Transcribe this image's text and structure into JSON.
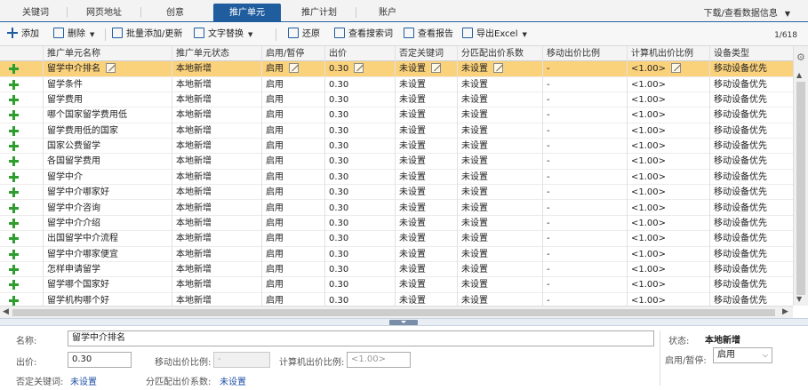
{
  "tabs": [
    {
      "label": "关键词",
      "active": false
    },
    {
      "label": "网页地址",
      "active": false
    },
    {
      "label": "创意",
      "active": false
    },
    {
      "label": "推广单元",
      "active": true
    },
    {
      "label": "推广计划",
      "active": false
    },
    {
      "label": "账户",
      "active": false
    }
  ],
  "download_label": "下载/查看数据信息",
  "toolbar": {
    "add": "添加",
    "delete": "删除",
    "batch": "批量添加/更新",
    "replace": "文字替换",
    "restore": "还原",
    "search_terms": "查看搜索词",
    "report": "查看报告",
    "export": "导出Excel",
    "page_count": "1/618"
  },
  "columns": [
    "推广单元名称",
    "推广单元状态",
    "启用/暂停",
    "出价",
    "否定关键词",
    "分匹配出价系数",
    "移动出价比例",
    "计算机出价比例",
    "设备类型"
  ],
  "rows": [
    [
      "留学中介排名",
      "本地新增",
      "启用",
      "0.30",
      "未设置",
      "未设置",
      "-",
      "<1.00>",
      "移动设备优先"
    ],
    [
      "留学条件",
      "本地新增",
      "启用",
      "0.30",
      "未设置",
      "未设置",
      "-",
      "<1.00>",
      "移动设备优先"
    ],
    [
      "留学费用",
      "本地新增",
      "启用",
      "0.30",
      "未设置",
      "未设置",
      "-",
      "<1.00>",
      "移动设备优先"
    ],
    [
      "哪个国家留学费用低",
      "本地新增",
      "启用",
      "0.30",
      "未设置",
      "未设置",
      "-",
      "<1.00>",
      "移动设备优先"
    ],
    [
      "留学费用低的国家",
      "本地新增",
      "启用",
      "0.30",
      "未设置",
      "未设置",
      "-",
      "<1.00>",
      "移动设备优先"
    ],
    [
      "国家公费留学",
      "本地新增",
      "启用",
      "0.30",
      "未设置",
      "未设置",
      "-",
      "<1.00>",
      "移动设备优先"
    ],
    [
      "各国留学费用",
      "本地新增",
      "启用",
      "0.30",
      "未设置",
      "未设置",
      "-",
      "<1.00>",
      "移动设备优先"
    ],
    [
      "留学中介",
      "本地新增",
      "启用",
      "0.30",
      "未设置",
      "未设置",
      "-",
      "<1.00>",
      "移动设备优先"
    ],
    [
      "留学中介哪家好",
      "本地新增",
      "启用",
      "0.30",
      "未设置",
      "未设置",
      "-",
      "<1.00>",
      "移动设备优先"
    ],
    [
      "留学中介咨询",
      "本地新增",
      "启用",
      "0.30",
      "未设置",
      "未设置",
      "-",
      "<1.00>",
      "移动设备优先"
    ],
    [
      "留学中介介绍",
      "本地新增",
      "启用",
      "0.30",
      "未设置",
      "未设置",
      "-",
      "<1.00>",
      "移动设备优先"
    ],
    [
      "出国留学中介流程",
      "本地新增",
      "启用",
      "0.30",
      "未设置",
      "未设置",
      "-",
      "<1.00>",
      "移动设备优先"
    ],
    [
      "留学中介哪家便宜",
      "本地新增",
      "启用",
      "0.30",
      "未设置",
      "未设置",
      "-",
      "<1.00>",
      "移动设备优先"
    ],
    [
      "怎样申请留学",
      "本地新增",
      "启用",
      "0.30",
      "未设置",
      "未设置",
      "-",
      "<1.00>",
      "移动设备优先"
    ],
    [
      "留学哪个国家好",
      "本地新增",
      "启用",
      "0.30",
      "未设置",
      "未设置",
      "-",
      "<1.00>",
      "移动设备优先"
    ],
    [
      "留学机构哪个好",
      "本地新增",
      "启用",
      "0.30",
      "未设置",
      "未设置",
      "-",
      "<1.00>",
      "移动设备优先"
    ]
  ],
  "detail": {
    "name_label": "名称:",
    "name_value": "留学中介排名",
    "bid_label": "出价:",
    "bid_value": "0.30",
    "mobile_ratio_label": "移动出价比例:",
    "mobile_ratio_value": "-",
    "pc_ratio_label": "计算机出价比例:",
    "pc_ratio_placeholder": "<1.00>",
    "neg_kw_label": "否定关键词:",
    "neg_kw_value": "未设置",
    "match_coef_label": "分匹配出价系数:",
    "match_coef_value": "未设置",
    "status_label": "状态:",
    "status_value": "本地新增",
    "enable_label": "启用/暂停:",
    "enable_value": "启用"
  },
  "colors": {
    "accent": "#1f5d9e",
    "selected_row": "#fbd27c",
    "add_green": "#2e9e2e",
    "link": "#1f4fa6"
  }
}
